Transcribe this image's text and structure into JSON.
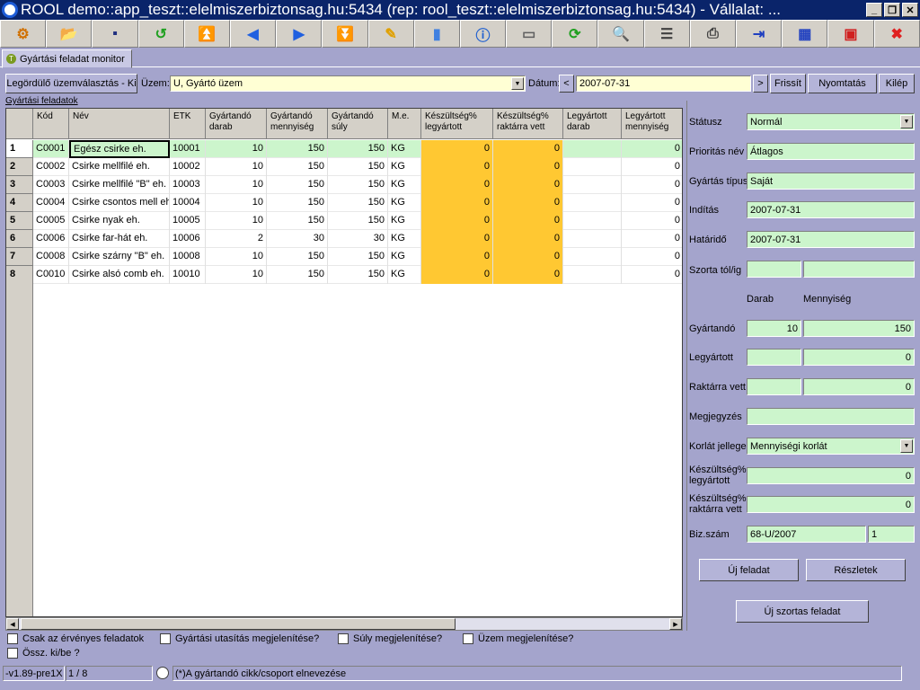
{
  "window": {
    "title": "ROOL demo::app_teszt::elelmiszerbiztonsag.hu:5434 (rep: rool_teszt::elelmiszerbiztonsag.hu:5434) - Vállalat: ..."
  },
  "toolbar": {
    "buttons": [
      "exit-run-icon",
      "open-folder-icon",
      "save-icon",
      "refresh-green-icon",
      "first-record-icon",
      "prev-record-icon",
      "next-record-icon",
      "last-record-icon",
      "edit-icon",
      "database-icon",
      "info-icon",
      "form-icon",
      "sync-icon",
      "search-icon",
      "grid-icon",
      "printer-icon",
      "export-icon",
      "table-icon",
      "window-icon",
      "close-red-icon"
    ]
  },
  "tab": {
    "label": "Gyártási feladat monitor"
  },
  "filter": {
    "select_plant_button": "Legördülő üzemválasztás - Ki",
    "plant_label": "Üzem:",
    "plant_value": "U, Gyártó üzem",
    "date_label": "Dátum:",
    "date_value": "2007-07-31",
    "prev": "<",
    "next": ">",
    "refresh": "Frissít",
    "print": "Nyomtatás",
    "exit": "Kilép"
  },
  "section_link": "Gyártási feladatok",
  "table": {
    "headers": [
      [
        "Kód",
        ""
      ],
      [
        "Név",
        ""
      ],
      [
        "ETK",
        ""
      ],
      [
        "Gyártandó",
        "darab"
      ],
      [
        "Gyártandó",
        "mennyiség"
      ],
      [
        "Gyártandó",
        "súly"
      ],
      [
        "M.e.",
        ""
      ],
      [
        "Készültség%",
        "legyártott"
      ],
      [
        "Készültség%",
        "raktárra vett"
      ],
      [
        "Legyártott",
        "darab"
      ],
      [
        "Legyártott",
        "mennyiség"
      ]
    ],
    "rows": [
      {
        "n": "1",
        "cells": [
          "C0001",
          "Egész csirke eh.",
          "10001",
          "10",
          "150",
          "150",
          "KG",
          "0",
          "0",
          "",
          "0"
        ]
      },
      {
        "n": "2",
        "cells": [
          "C0002",
          "Csirke mellfilé eh.",
          "10002",
          "10",
          "150",
          "150",
          "KG",
          "0",
          "0",
          "",
          "0"
        ]
      },
      {
        "n": "3",
        "cells": [
          "C0003",
          "Csirke mellfilé \"B\" eh.",
          "10003",
          "10",
          "150",
          "150",
          "KG",
          "0",
          "0",
          "",
          "0"
        ]
      },
      {
        "n": "4",
        "cells": [
          "C0004",
          "Csirke csontos mell eh",
          "10004",
          "10",
          "150",
          "150",
          "KG",
          "0",
          "0",
          "",
          "0"
        ]
      },
      {
        "n": "5",
        "cells": [
          "C0005",
          "Csirke nyak eh.",
          "10005",
          "10",
          "150",
          "150",
          "KG",
          "0",
          "0",
          "",
          "0"
        ]
      },
      {
        "n": "6",
        "cells": [
          "C0006",
          "Csirke far-hát eh.",
          "10006",
          "2",
          "30",
          "30",
          "KG",
          "0",
          "0",
          "",
          "0"
        ]
      },
      {
        "n": "7",
        "cells": [
          "C0008",
          "Csirke szárny \"B\" eh.",
          "10008",
          "10",
          "150",
          "150",
          "KG",
          "0",
          "0",
          "",
          "0"
        ]
      },
      {
        "n": "8",
        "cells": [
          "C0010",
          "Csirke alsó comb eh.",
          "10010",
          "10",
          "150",
          "150",
          "KG",
          "0",
          "0",
          "",
          "0"
        ]
      }
    ]
  },
  "options": {
    "only_valid": "Csak az érvényes feladatok",
    "show_instructions": "Gyártási utasítás megjelenítése?",
    "show_weight": "Súly megjelenítése?",
    "show_plant": "Üzem megjelenítése?",
    "sum_toggle": "Össz. ki/be ?"
  },
  "statusbar": {
    "version": "-v1.89-pre1X",
    "record": "1 / 8",
    "note": "(*)A gyártandó cikk/csoport elnevezése"
  },
  "detail": {
    "status_label": "Státusz",
    "status_value": "Normál",
    "priority_label": "Prioritás név",
    "priority_value": "Átlagos",
    "type_label": "Gyártás típus",
    "type_value": "Saját",
    "start_label": "Indítás",
    "start_value": "2007-07-31",
    "deadline_label": "Határidő",
    "deadline_value": "2007-07-31",
    "batch_label": "Szorta tól/ig",
    "col_count": "Darab",
    "col_qty": "Mennyiség",
    "planned_label": "Gyártandó",
    "planned_count": "10",
    "planned_qty": "150",
    "produced_label": "Legyártott",
    "produced_qty": "0",
    "stored_label": "Raktárra vett",
    "stored_qty": "0",
    "note_label": "Megjegyzés",
    "limit_label": "Korlát jellege",
    "limit_value": "Mennyiségi korlát",
    "pct_produced_label1": "Készültség%",
    "pct_produced_label2": "legyártott",
    "pct_produced_value": "0",
    "pct_stored_label1": "Készültség%",
    "pct_stored_label2": "raktárra vett",
    "pct_stored_value": "0",
    "doc_label": "Biz.szám",
    "doc_value": "68-U/2007",
    "doc_sub": "1",
    "new_task": "Új feladat",
    "details": "Részletek",
    "new_batch_task": "Új szortas feladat"
  }
}
